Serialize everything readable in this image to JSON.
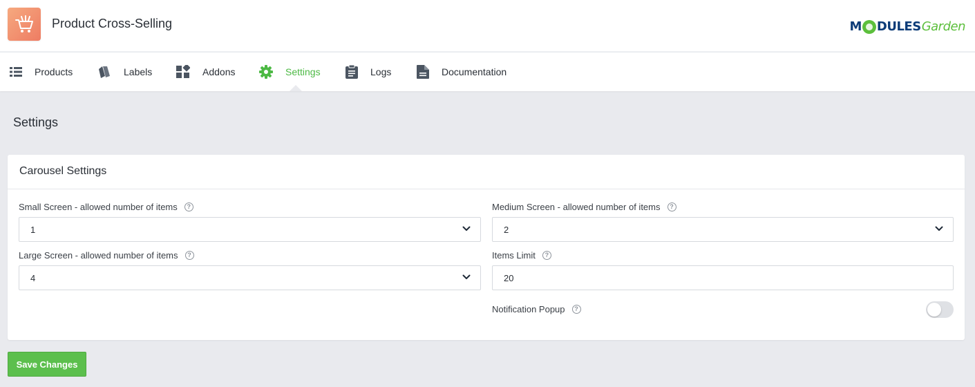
{
  "app": {
    "title": "Product Cross-Selling",
    "icon": "cart-icon",
    "brand_part1": "M",
    "brand_part2": "DULES",
    "brand_part3": "Garden",
    "brand_colors": {
      "navy": "#0d3c78",
      "green": "#5cbf3c"
    }
  },
  "nav": {
    "items": [
      {
        "label": "Products",
        "icon": "list-icon"
      },
      {
        "label": "Labels",
        "icon": "labels-icon"
      },
      {
        "label": "Addons",
        "icon": "addons-icon"
      },
      {
        "label": "Settings",
        "icon": "gear-icon",
        "active": true
      },
      {
        "label": "Logs",
        "icon": "clipboard-icon"
      },
      {
        "label": "Documentation",
        "icon": "document-icon"
      }
    ],
    "active_color": "#4cb944"
  },
  "page": {
    "title": "Settings"
  },
  "panel": {
    "title": "Carousel Settings",
    "fields": {
      "small_screen": {
        "label": "Small Screen - allowed number of items",
        "value": "1"
      },
      "medium_screen": {
        "label": "Medium Screen - allowed number of items",
        "value": "2"
      },
      "large_screen": {
        "label": "Large Screen - allowed number of items",
        "value": "4"
      },
      "items_limit": {
        "label": "Items Limit",
        "value": "20"
      },
      "notification_popup": {
        "label": "Notification Popup",
        "enabled": false
      }
    }
  },
  "actions": {
    "save_label": "Save Changes",
    "save_color": "#5cbf4d"
  }
}
